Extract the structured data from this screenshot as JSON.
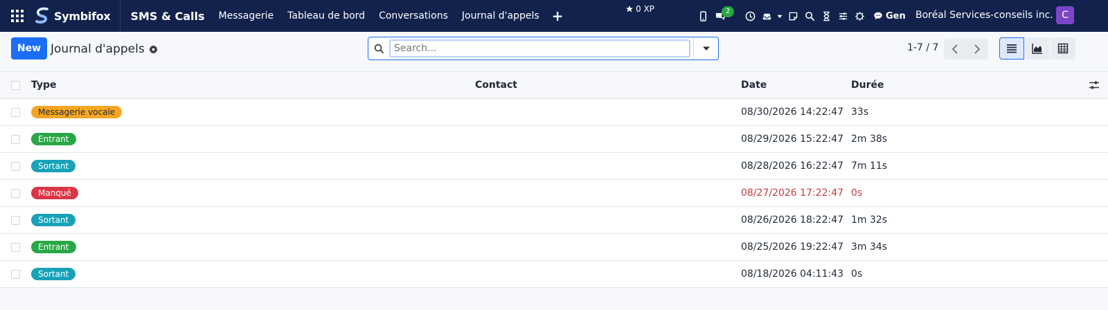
{
  "nav": {
    "brand": "Symbifox",
    "app": "SMS & Calls",
    "items": [
      "Messagerie",
      "Tableau de bord",
      "Conversations",
      "Journal d'appels"
    ],
    "plus": "+",
    "xp": "0 XP",
    "chat_count": "2",
    "gen": "Gen",
    "company": "Boréal Services-conseils inc.",
    "avatar_initial": "C"
  },
  "control": {
    "new_label": "New",
    "title": "Journal d'appels",
    "search_placeholder": "Search...",
    "pager": "1-7 / 7"
  },
  "table": {
    "headers": {
      "type": "Type",
      "contact": "Contact",
      "date": "Date",
      "duration": "Durée"
    },
    "rows": [
      {
        "type": "Messagerie vocale",
        "type_color": "#f5a623",
        "type_text_color": "#1f2937",
        "contact": "",
        "date": "08/30/2026 14:22:47",
        "duration": "33s",
        "missed": false
      },
      {
        "type": "Entrant",
        "type_color": "#28a745",
        "type_text_color": "#ffffff",
        "contact": "",
        "date": "08/29/2026 15:22:47",
        "duration": "2m 38s",
        "missed": false
      },
      {
        "type": "Sortant",
        "type_color": "#17a2b8",
        "type_text_color": "#ffffff",
        "contact": "",
        "date": "08/28/2026 16:22:47",
        "duration": "7m 11s",
        "missed": false
      },
      {
        "type": "Manqué",
        "type_color": "#dc3545",
        "type_text_color": "#ffffff",
        "contact": "",
        "date": "08/27/2026 17:22:47",
        "duration": "0s",
        "missed": true
      },
      {
        "type": "Sortant",
        "type_color": "#17a2b8",
        "type_text_color": "#ffffff",
        "contact": "",
        "date": "08/26/2026 18:22:47",
        "duration": "1m 32s",
        "missed": false
      },
      {
        "type": "Entrant",
        "type_color": "#28a745",
        "type_text_color": "#ffffff",
        "contact": "",
        "date": "08/25/2026 19:22:47",
        "duration": "3m 34s",
        "missed": false
      },
      {
        "type": "Sortant",
        "type_color": "#17a2b8",
        "type_text_color": "#ffffff",
        "contact": "",
        "date": "08/18/2026 04:11:43",
        "duration": "0s",
        "missed": false
      }
    ]
  },
  "colors": {
    "navbar": "#12224d",
    "accent": "#1b6ef3",
    "missed": "#c43c3c"
  }
}
